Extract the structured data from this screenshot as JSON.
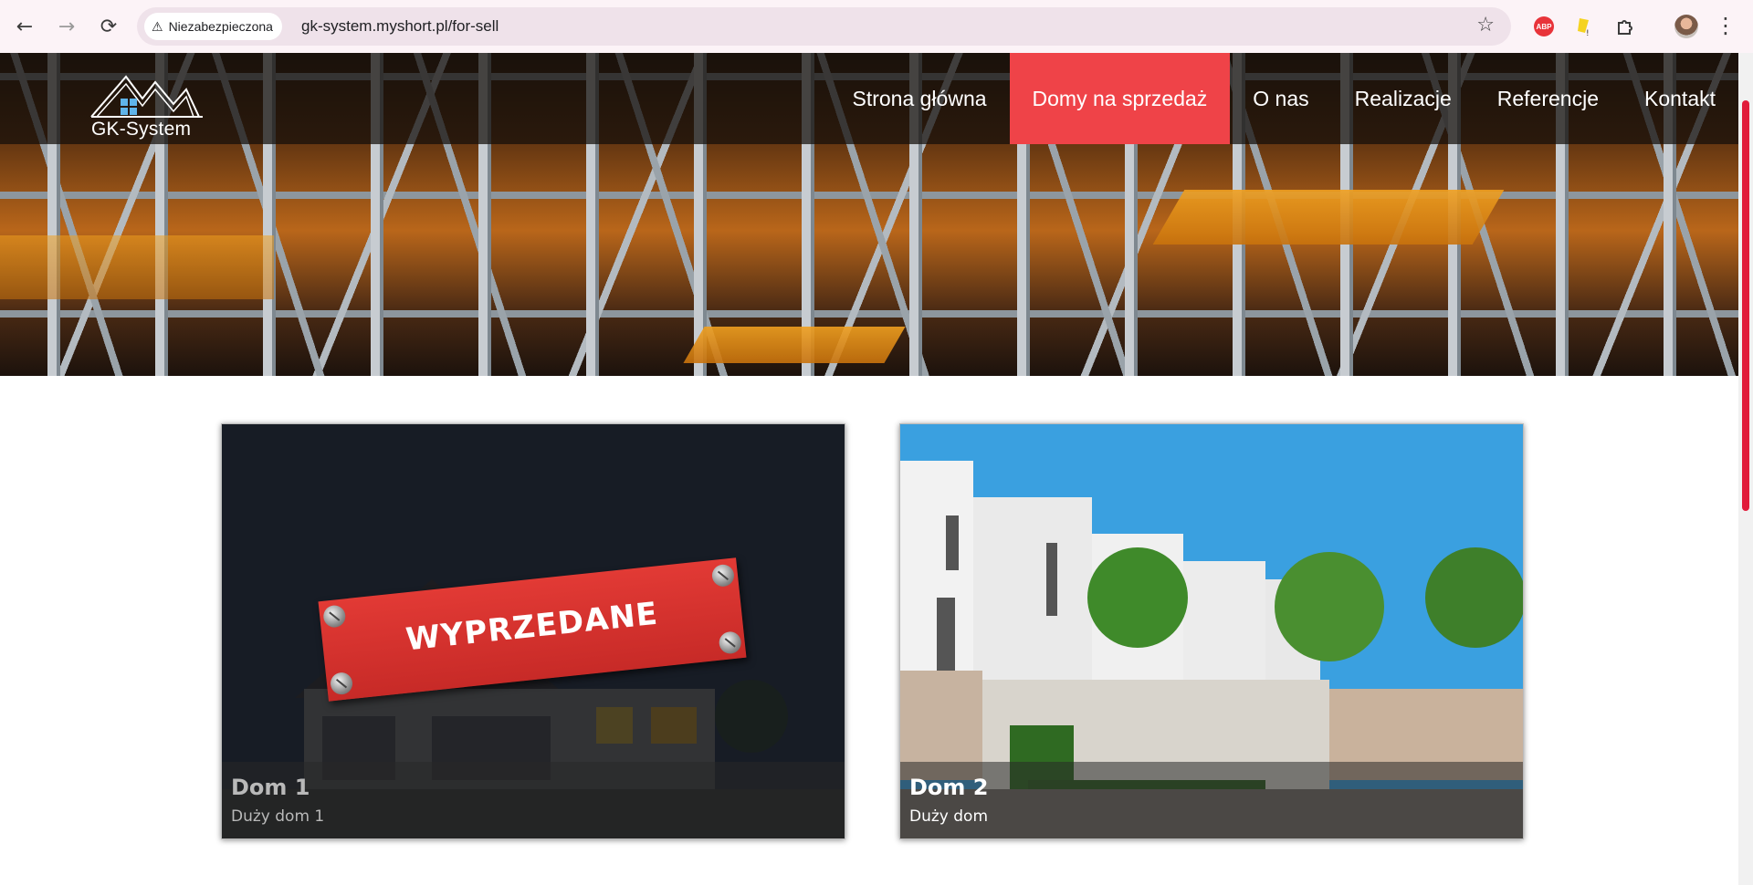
{
  "browser": {
    "back_icon": "arrow-left-icon",
    "forward_icon": "arrow-right-icon",
    "reload_icon": "reload-icon",
    "security_label": "Niezabezpieczona",
    "url": "gk-system.myshort.pl/for-sell",
    "extensions": [
      "adblock-plus-icon",
      "yellow-extension-icon",
      "puzzle-extensions-icon",
      "profile-avatar-icon"
    ],
    "abp_label": "ABP"
  },
  "site": {
    "logo_text": "GK-System",
    "menu": [
      {
        "label": "Strona główna",
        "active": false
      },
      {
        "label": "Domy na sprzedaż",
        "active": true
      },
      {
        "label": "O nas",
        "active": false
      },
      {
        "label": "Realizacje",
        "active": false
      },
      {
        "label": "Referencje",
        "active": false
      },
      {
        "label": "Kontakt",
        "active": false
      }
    ],
    "accent_color": "#ef4348"
  },
  "listings": [
    {
      "title": "Dom 1",
      "subtitle": "Duży dom 1",
      "sold": true,
      "sold_label": "WYPRZEDANE"
    },
    {
      "title": "Dom 2",
      "subtitle": "Duży dom",
      "sold": false
    }
  ]
}
